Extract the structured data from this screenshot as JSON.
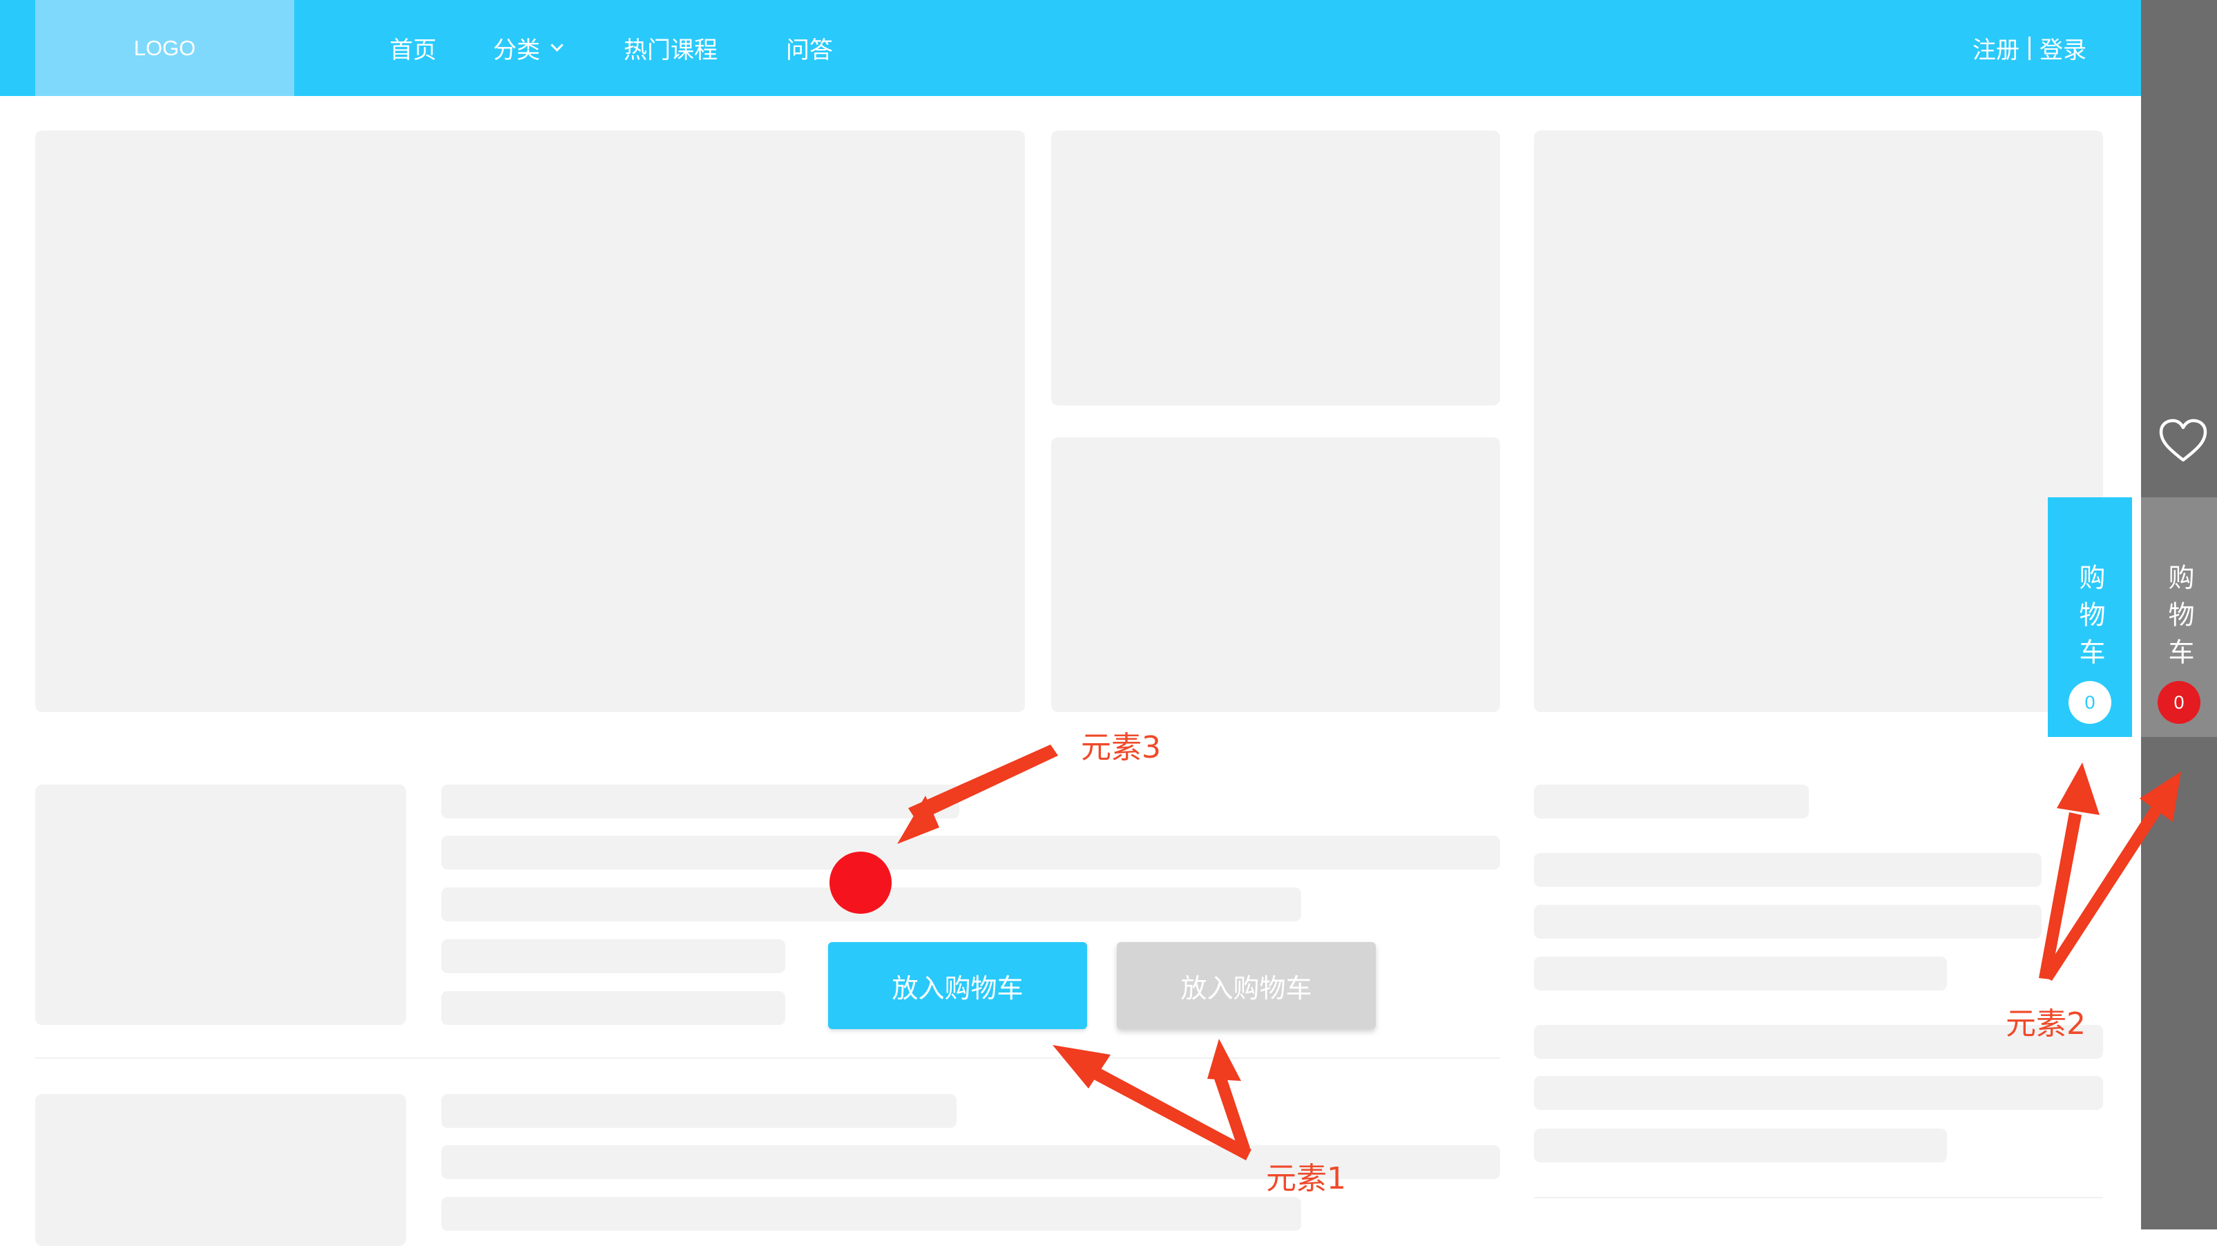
{
  "header": {
    "logo": "LOGO",
    "nav": {
      "home": "首页",
      "category": "分类",
      "hot_courses": "热门课程",
      "qa": "问答"
    },
    "register": "注册",
    "login": "登录"
  },
  "buttons": {
    "add_to_cart_primary": "放入购物车",
    "add_to_cart_secondary": "放入购物车"
  },
  "sidebar": {
    "cart_tab_blue": {
      "label": "购物车",
      "count": "0"
    },
    "cart_tab_gray": {
      "label": "购物车",
      "count": "0"
    }
  },
  "annotations": {
    "element1": "元素1",
    "element2": "元素2",
    "element3": "元素3"
  },
  "colors": {
    "primary": "#29cafb",
    "logo_bg": "#7fd9fc",
    "placeholder": "#f2f2f2",
    "disabled_button": "#d5d5d5",
    "sidebar": "#6d6d6d",
    "ball": "#f5131d",
    "annotation": "#ef4a2a"
  },
  "icons": {
    "dropdown": "chevron-down-icon",
    "favorite": "heart-icon"
  }
}
